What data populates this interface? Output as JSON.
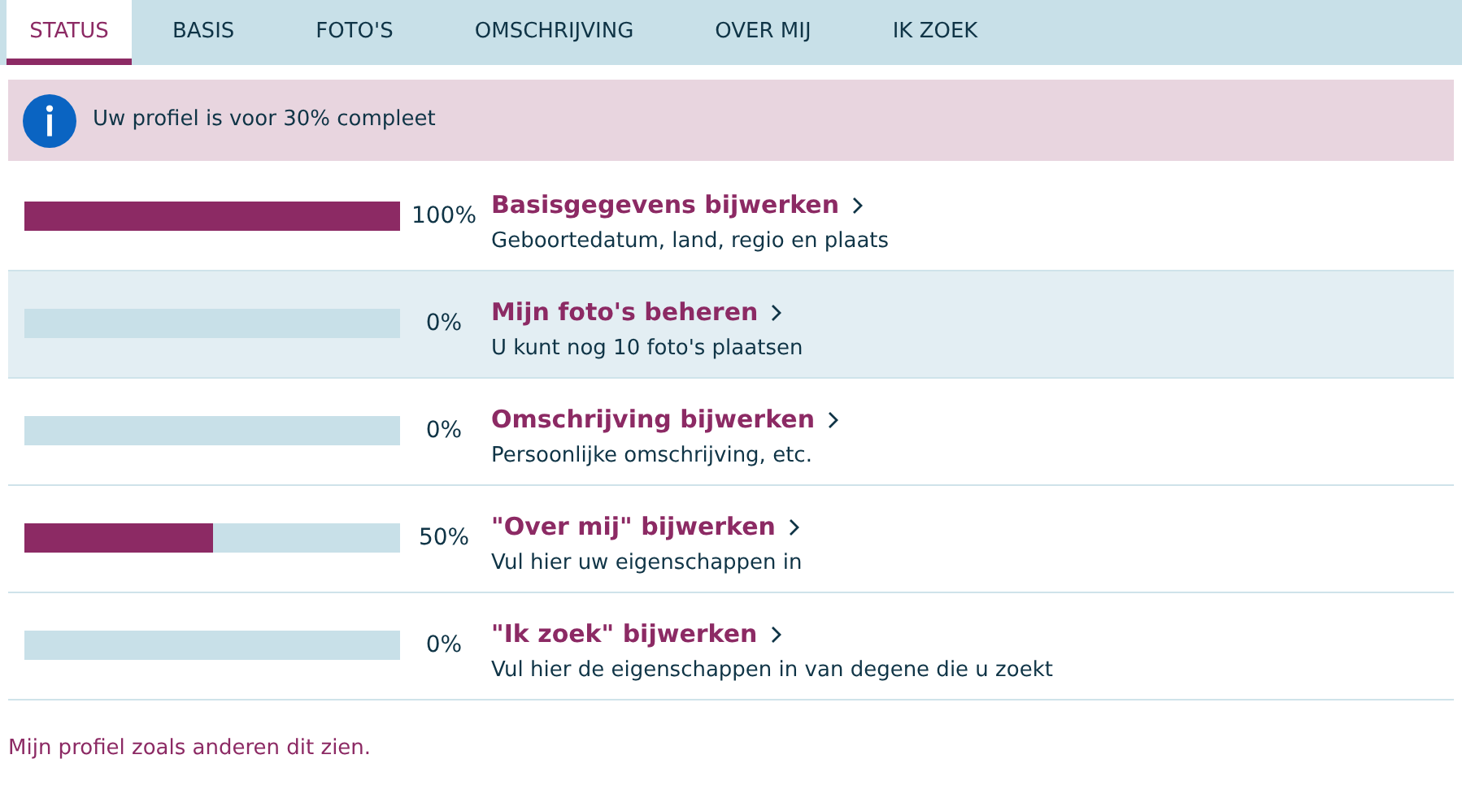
{
  "tabs": [
    {
      "label": "STATUS",
      "selected": true
    },
    {
      "label": "BASIS",
      "selected": false
    },
    {
      "label": "FOTO'S",
      "selected": false
    },
    {
      "label": "OMSCHRIJVING",
      "selected": false
    },
    {
      "label": "OVER MIJ",
      "selected": false
    },
    {
      "label": "IK ZOEK",
      "selected": false
    }
  ],
  "notice": {
    "text": "Uw profiel is voor 30% compleet"
  },
  "steps": [
    {
      "level": 1,
      "reading": "100%",
      "title": "Basisgegevens bijwerken",
      "subtitle": "Geboortedatum, land, regio en plaats",
      "selected": false
    },
    {
      "level": 0,
      "reading": "0%",
      "title": "Mijn foto's beheren",
      "subtitle": "U kunt nog 10 foto's plaatsen",
      "selected": true
    },
    {
      "level": 0,
      "reading": "0%",
      "title": "Omschrijving bijwerken",
      "subtitle": "Persoonlijke omschrijving, etc.",
      "selected": false
    },
    {
      "level": 0.5,
      "reading": "50%",
      "title": "\"Over mij\" bijwerken",
      "subtitle": "Vul hier uw eigenschappen in",
      "selected": false
    },
    {
      "level": 0,
      "reading": "0%",
      "title": "\"Ik zoek\" bijwerken",
      "subtitle": "Vul hier de eigenschappen in van degene die u zoekt",
      "selected": false
    }
  ],
  "footer_link": "Mijn profiel zoals anderen dit zien."
}
